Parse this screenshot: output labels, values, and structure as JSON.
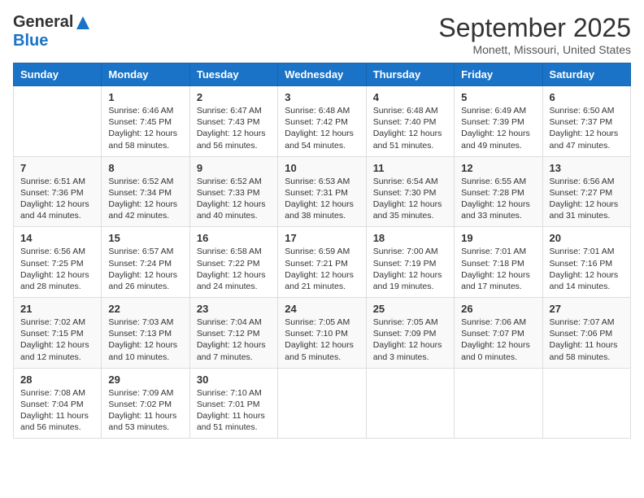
{
  "logo": {
    "general": "General",
    "blue": "Blue"
  },
  "title": "September 2025",
  "location": "Monett, Missouri, United States",
  "days_of_week": [
    "Sunday",
    "Monday",
    "Tuesday",
    "Wednesday",
    "Thursday",
    "Friday",
    "Saturday"
  ],
  "weeks": [
    [
      {
        "day": "",
        "text": ""
      },
      {
        "day": "1",
        "text": "Sunrise: 6:46 AM\nSunset: 7:45 PM\nDaylight: 12 hours\nand 58 minutes."
      },
      {
        "day": "2",
        "text": "Sunrise: 6:47 AM\nSunset: 7:43 PM\nDaylight: 12 hours\nand 56 minutes."
      },
      {
        "day": "3",
        "text": "Sunrise: 6:48 AM\nSunset: 7:42 PM\nDaylight: 12 hours\nand 54 minutes."
      },
      {
        "day": "4",
        "text": "Sunrise: 6:48 AM\nSunset: 7:40 PM\nDaylight: 12 hours\nand 51 minutes."
      },
      {
        "day": "5",
        "text": "Sunrise: 6:49 AM\nSunset: 7:39 PM\nDaylight: 12 hours\nand 49 minutes."
      },
      {
        "day": "6",
        "text": "Sunrise: 6:50 AM\nSunset: 7:37 PM\nDaylight: 12 hours\nand 47 minutes."
      }
    ],
    [
      {
        "day": "7",
        "text": "Sunrise: 6:51 AM\nSunset: 7:36 PM\nDaylight: 12 hours\nand 44 minutes."
      },
      {
        "day": "8",
        "text": "Sunrise: 6:52 AM\nSunset: 7:34 PM\nDaylight: 12 hours\nand 42 minutes."
      },
      {
        "day": "9",
        "text": "Sunrise: 6:52 AM\nSunset: 7:33 PM\nDaylight: 12 hours\nand 40 minutes."
      },
      {
        "day": "10",
        "text": "Sunrise: 6:53 AM\nSunset: 7:31 PM\nDaylight: 12 hours\nand 38 minutes."
      },
      {
        "day": "11",
        "text": "Sunrise: 6:54 AM\nSunset: 7:30 PM\nDaylight: 12 hours\nand 35 minutes."
      },
      {
        "day": "12",
        "text": "Sunrise: 6:55 AM\nSunset: 7:28 PM\nDaylight: 12 hours\nand 33 minutes."
      },
      {
        "day": "13",
        "text": "Sunrise: 6:56 AM\nSunset: 7:27 PM\nDaylight: 12 hours\nand 31 minutes."
      }
    ],
    [
      {
        "day": "14",
        "text": "Sunrise: 6:56 AM\nSunset: 7:25 PM\nDaylight: 12 hours\nand 28 minutes."
      },
      {
        "day": "15",
        "text": "Sunrise: 6:57 AM\nSunset: 7:24 PM\nDaylight: 12 hours\nand 26 minutes."
      },
      {
        "day": "16",
        "text": "Sunrise: 6:58 AM\nSunset: 7:22 PM\nDaylight: 12 hours\nand 24 minutes."
      },
      {
        "day": "17",
        "text": "Sunrise: 6:59 AM\nSunset: 7:21 PM\nDaylight: 12 hours\nand 21 minutes."
      },
      {
        "day": "18",
        "text": "Sunrise: 7:00 AM\nSunset: 7:19 PM\nDaylight: 12 hours\nand 19 minutes."
      },
      {
        "day": "19",
        "text": "Sunrise: 7:01 AM\nSunset: 7:18 PM\nDaylight: 12 hours\nand 17 minutes."
      },
      {
        "day": "20",
        "text": "Sunrise: 7:01 AM\nSunset: 7:16 PM\nDaylight: 12 hours\nand 14 minutes."
      }
    ],
    [
      {
        "day": "21",
        "text": "Sunrise: 7:02 AM\nSunset: 7:15 PM\nDaylight: 12 hours\nand 12 minutes."
      },
      {
        "day": "22",
        "text": "Sunrise: 7:03 AM\nSunset: 7:13 PM\nDaylight: 12 hours\nand 10 minutes."
      },
      {
        "day": "23",
        "text": "Sunrise: 7:04 AM\nSunset: 7:12 PM\nDaylight: 12 hours\nand 7 minutes."
      },
      {
        "day": "24",
        "text": "Sunrise: 7:05 AM\nSunset: 7:10 PM\nDaylight: 12 hours\nand 5 minutes."
      },
      {
        "day": "25",
        "text": "Sunrise: 7:05 AM\nSunset: 7:09 PM\nDaylight: 12 hours\nand 3 minutes."
      },
      {
        "day": "26",
        "text": "Sunrise: 7:06 AM\nSunset: 7:07 PM\nDaylight: 12 hours\nand 0 minutes."
      },
      {
        "day": "27",
        "text": "Sunrise: 7:07 AM\nSunset: 7:06 PM\nDaylight: 11 hours\nand 58 minutes."
      }
    ],
    [
      {
        "day": "28",
        "text": "Sunrise: 7:08 AM\nSunset: 7:04 PM\nDaylight: 11 hours\nand 56 minutes."
      },
      {
        "day": "29",
        "text": "Sunrise: 7:09 AM\nSunset: 7:02 PM\nDaylight: 11 hours\nand 53 minutes."
      },
      {
        "day": "30",
        "text": "Sunrise: 7:10 AM\nSunset: 7:01 PM\nDaylight: 11 hours\nand 51 minutes."
      },
      {
        "day": "",
        "text": ""
      },
      {
        "day": "",
        "text": ""
      },
      {
        "day": "",
        "text": ""
      },
      {
        "day": "",
        "text": ""
      }
    ]
  ]
}
